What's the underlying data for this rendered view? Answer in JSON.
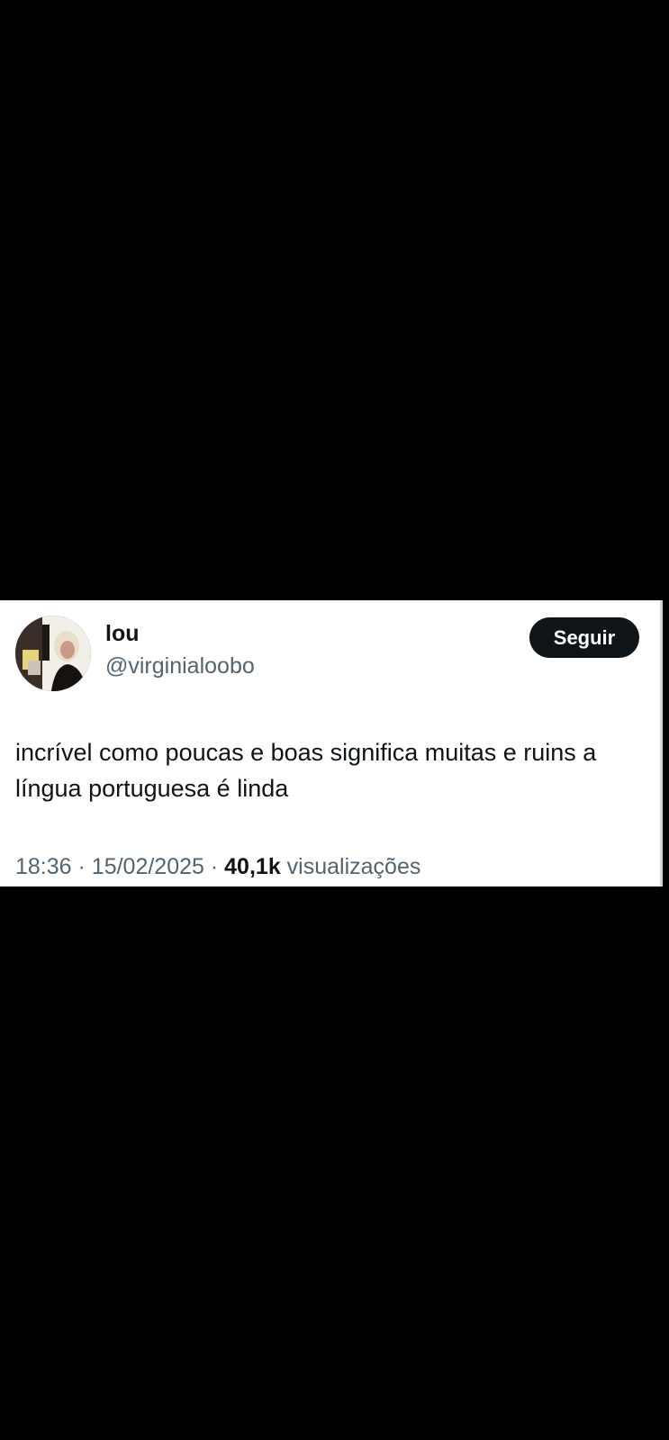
{
  "tweet": {
    "author": {
      "display_name": "lou",
      "handle": "@virginialoobo",
      "avatar_icon": "profile-photo"
    },
    "follow_label": "Seguir",
    "text": "incrível como poucas e boas significa muitas e ruins a língua portuguesa é linda",
    "time": "18:36",
    "date": "15/02/2025",
    "separator": "·",
    "views_count": "40,1k",
    "views_label": "visualizações"
  },
  "colors": {
    "background": "#000000",
    "card": "#ffffff",
    "primary_text": "#0f1419",
    "secondary_text": "#536471",
    "button_bg": "#0f1419",
    "button_text": "#ffffff"
  }
}
